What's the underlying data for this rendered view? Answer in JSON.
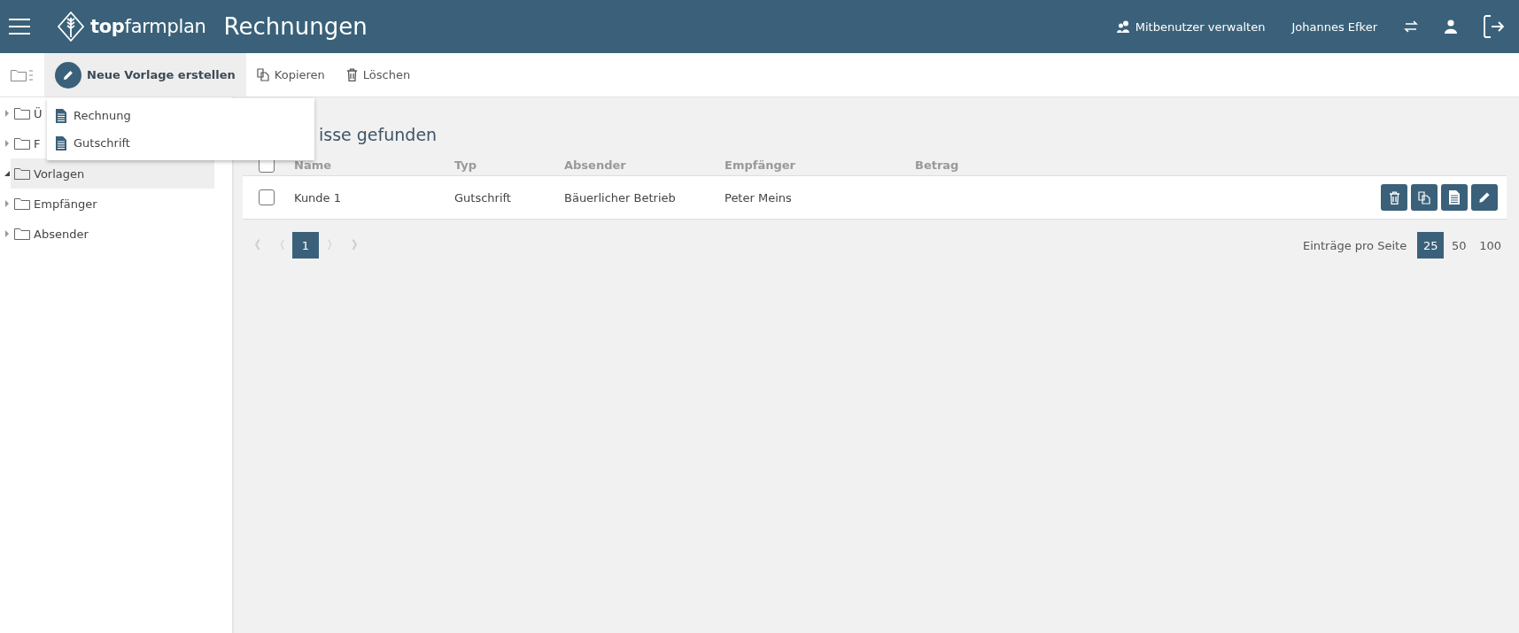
{
  "header": {
    "brand_bold": "top",
    "brand_rest": "farmplan",
    "title": "Rechnungen",
    "share_link": "Mitbenutzer verwalten",
    "user_name": "Johannes Efker"
  },
  "toolbar": {
    "new_button": "Neue Vorlage erstellen",
    "copy_button": "Kopieren",
    "delete_button": "Löschen"
  },
  "dropdown": {
    "items": [
      {
        "label": "Rechnung"
      },
      {
        "label": "Gutschrift"
      }
    ]
  },
  "sidebar": {
    "items": [
      {
        "label": "Ü",
        "expanded": false,
        "selected": false
      },
      {
        "label": "F",
        "expanded": false,
        "selected": false
      },
      {
        "label": "Vorlagen",
        "expanded": true,
        "selected": true
      },
      {
        "label": "Empfänger",
        "expanded": false,
        "selected": false
      },
      {
        "label": "Absender",
        "expanded": false,
        "selected": false
      }
    ]
  },
  "results_heading": "isse gefunden",
  "table": {
    "columns": [
      "Name",
      "Typ",
      "Absender",
      "Empfänger",
      "Betrag"
    ],
    "select_all_checked": false,
    "rows": [
      {
        "checked": false,
        "cells": [
          "Kunde 1",
          "Gutschrift",
          "Bäuerlicher Betrieb",
          "Peter Meins",
          ""
        ]
      }
    ]
  },
  "pagination": {
    "first": "《",
    "prev": "〈",
    "pages": [
      {
        "label": "1",
        "selected": true
      }
    ],
    "next": "〉",
    "last": "》"
  },
  "page_size": {
    "label": "Einträge pro Seite",
    "options": [
      {
        "label": "25",
        "selected": true
      },
      {
        "label": "50",
        "selected": false
      },
      {
        "label": "100",
        "selected": false
      }
    ]
  }
}
